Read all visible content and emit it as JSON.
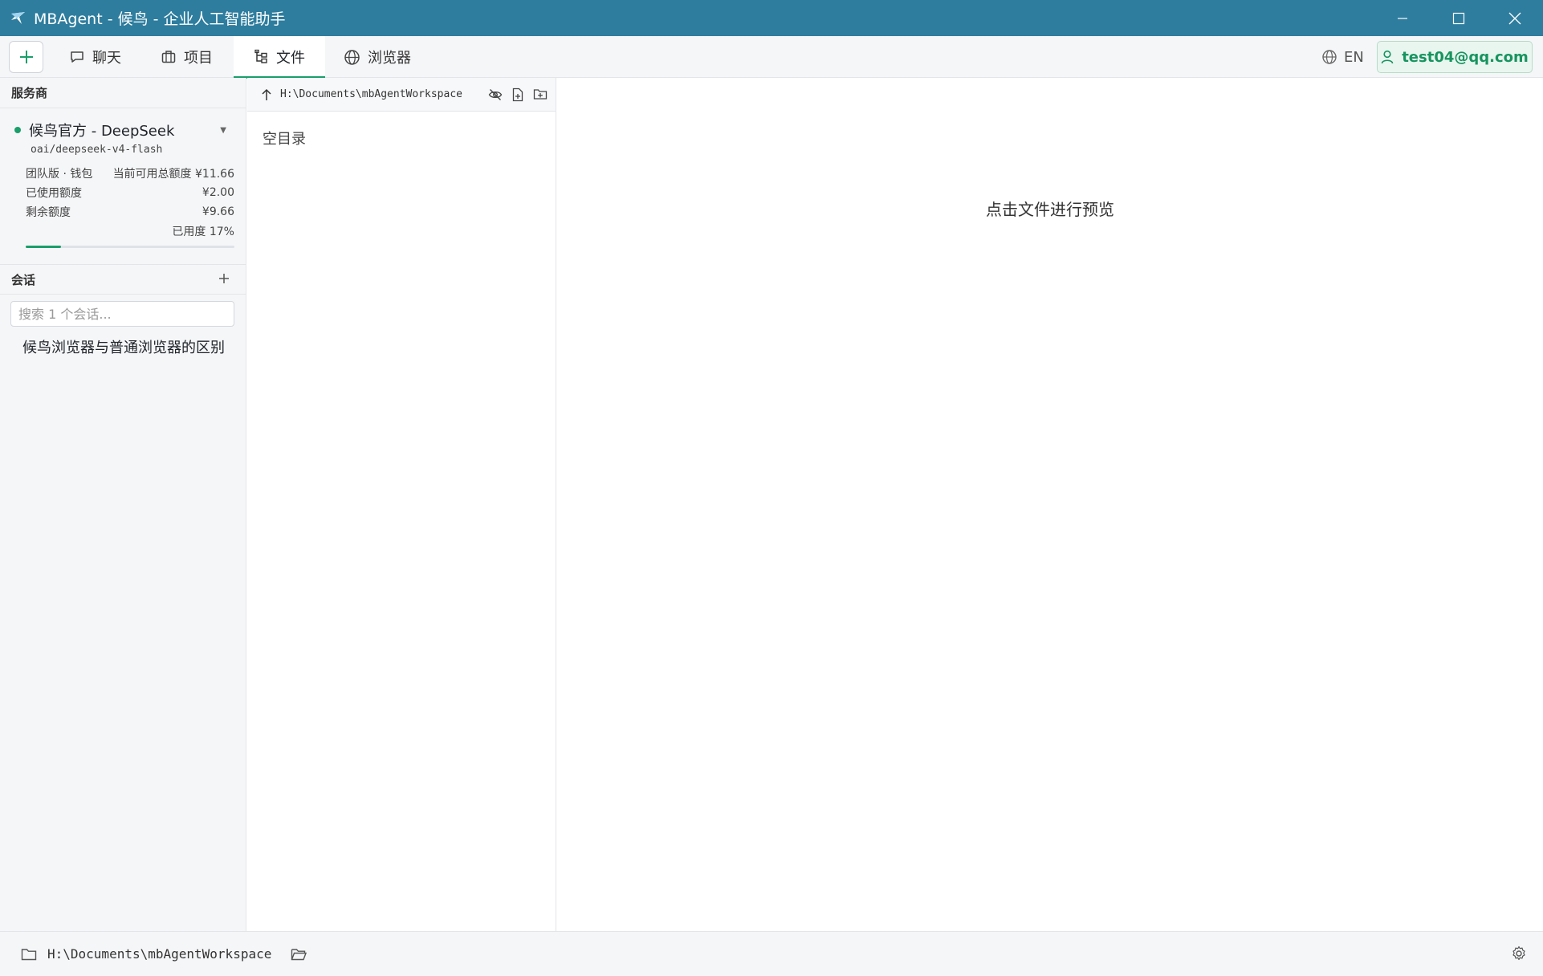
{
  "window": {
    "title": "MBAgent - 候鸟 - 企业人工智能助手",
    "app_icon": "bird-logo-icon"
  },
  "tabs": {
    "new_icon": "plus-icon",
    "items": [
      {
        "label": "聊天",
        "icon": "chat-bubble-icon"
      },
      {
        "label": "项目",
        "icon": "briefcase-icon"
      },
      {
        "label": "文件",
        "icon": "file-tree-icon"
      },
      {
        "label": "浏览器",
        "icon": "globe-icon"
      }
    ],
    "active": "文件"
  },
  "header": {
    "language": "EN",
    "user_email": "test04@qq.com"
  },
  "sidebar": {
    "provider_header": "服务商",
    "provider_name": "候鸟官方 - DeepSeek",
    "model": "oai/deepseek-v4-flash",
    "quota": {
      "plan": "团队版 · 钱包",
      "total_label": "当前可用总额度 ¥11.66",
      "used_label": "已使用额度",
      "used_value": "¥2.00",
      "remain_label": "剩余额度",
      "remain_value": "¥9.66",
      "usage_text": "已用度 17%",
      "usage_fraction": 0.17
    },
    "sessions_header": "会话",
    "search_placeholder": "搜索 1 个会话...",
    "sessions": [
      "候鸟浏览器与普通浏览器的区别"
    ]
  },
  "files": {
    "path": "H:\\Documents\\mbAgentWorkspace",
    "empty_text": "空目录"
  },
  "preview": {
    "hint": "点击文件进行预览"
  },
  "status": {
    "workspace_path": "H:\\Documents\\mbAgentWorkspace"
  },
  "colors": {
    "titlebar": "#2e7d9e",
    "accent": "#1a9e6a"
  }
}
